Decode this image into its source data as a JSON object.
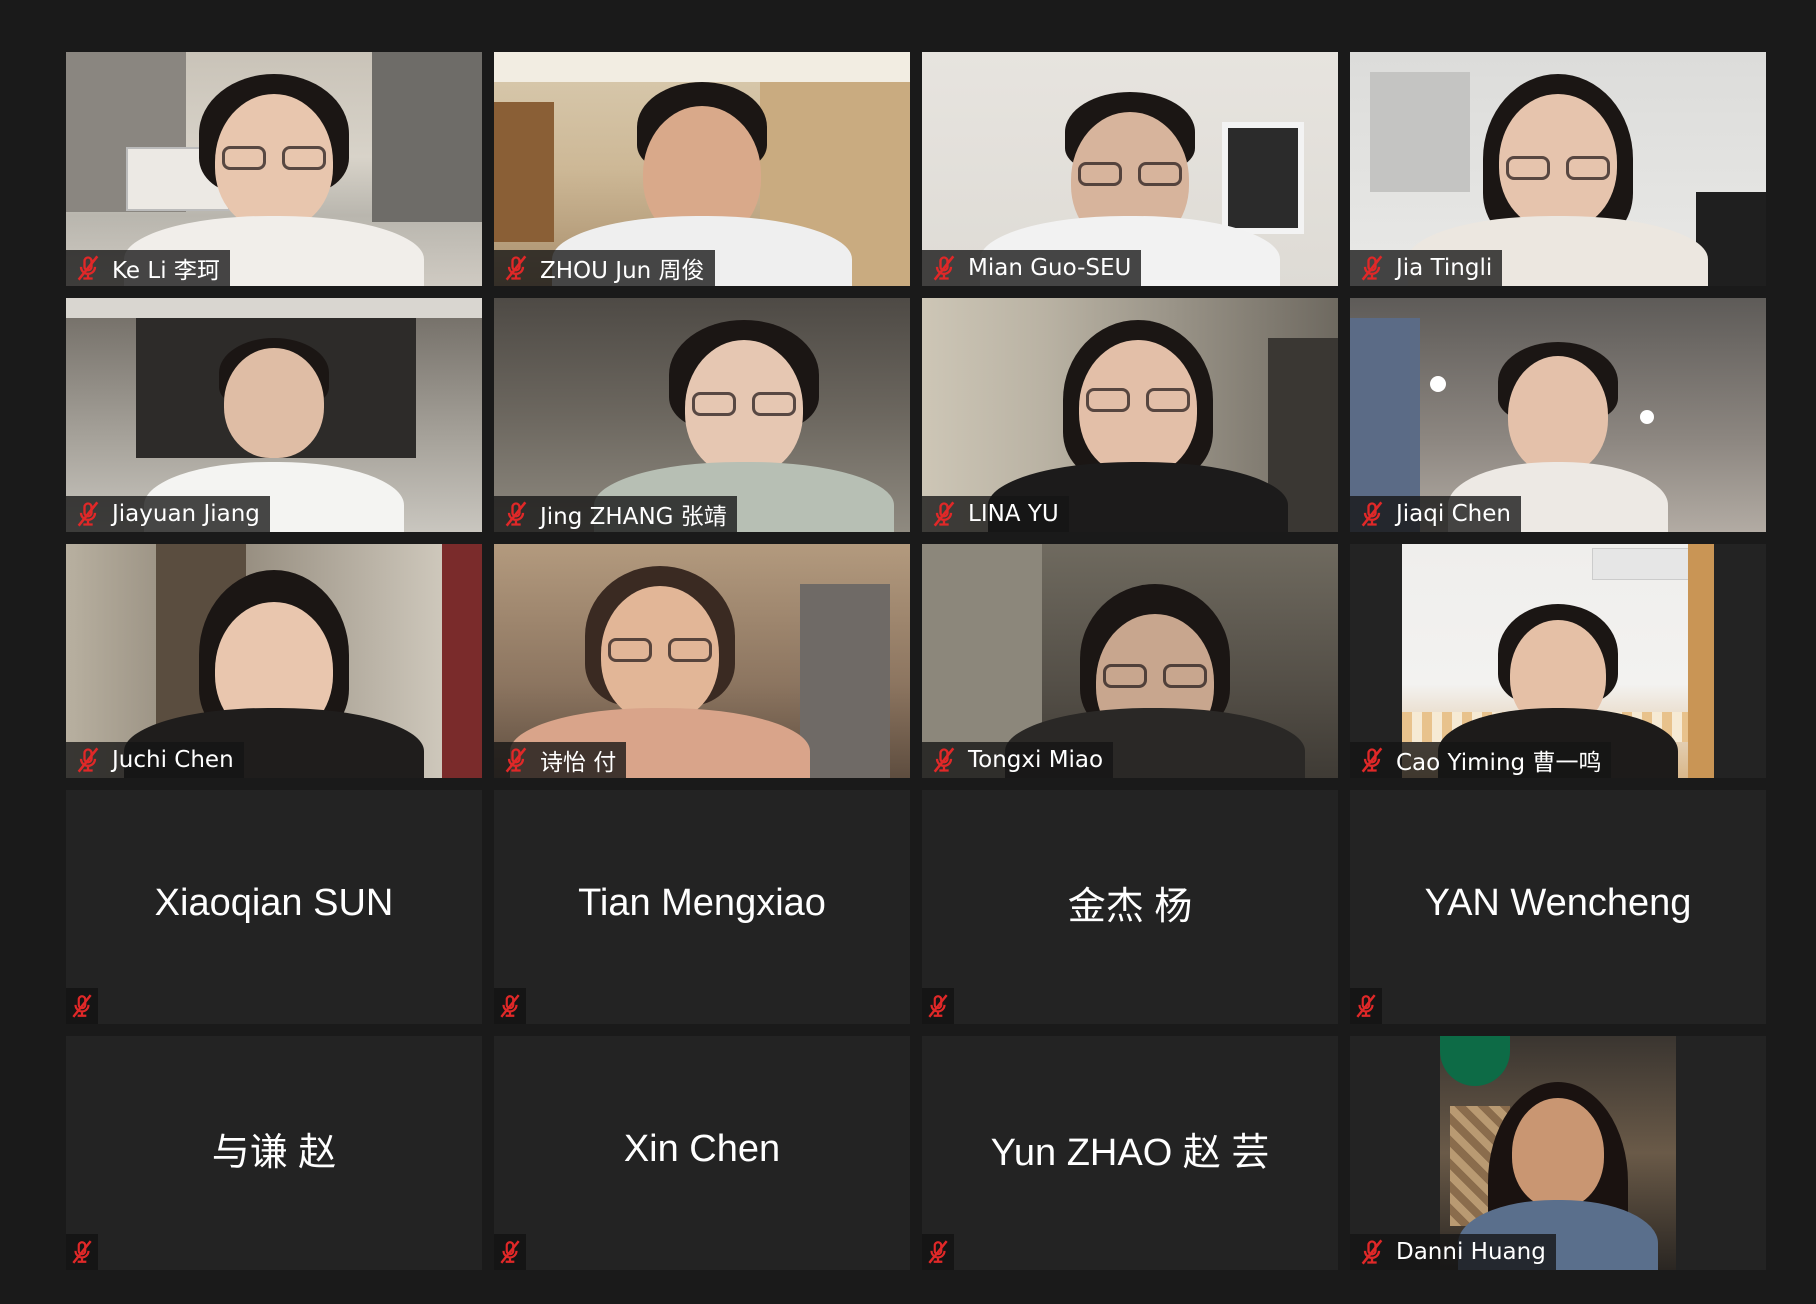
{
  "participants": [
    {
      "name": "Ke Li 李珂",
      "video": true,
      "muted": true
    },
    {
      "name": "ZHOU Jun 周俊",
      "video": true,
      "muted": true
    },
    {
      "name": "Mian Guo-SEU",
      "video": true,
      "muted": true
    },
    {
      "name": "Jia Tingli",
      "video": true,
      "muted": true
    },
    {
      "name": "Jiayuan Jiang",
      "video": true,
      "muted": true
    },
    {
      "name": "Jing ZHANG 张靖",
      "video": true,
      "muted": true
    },
    {
      "name": "LINA YU",
      "video": true,
      "muted": true
    },
    {
      "name": "Jiaqi Chen",
      "video": true,
      "muted": true
    },
    {
      "name": "Juchi Chen",
      "video": true,
      "muted": true
    },
    {
      "name": "诗怡 付",
      "video": true,
      "muted": true
    },
    {
      "name": "Tongxi Miao",
      "video": true,
      "muted": true
    },
    {
      "name": "Cao Yiming 曹一鸣",
      "video": true,
      "muted": true
    },
    {
      "name": "Xiaoqian SUN",
      "video": false,
      "muted": true
    },
    {
      "name": "Tian Mengxiao",
      "video": false,
      "muted": true
    },
    {
      "name": "金杰 杨",
      "video": false,
      "muted": true
    },
    {
      "name": "YAN Wencheng",
      "video": false,
      "muted": true
    },
    {
      "name": "与谦 赵",
      "video": false,
      "muted": true
    },
    {
      "name": "Xin Chen",
      "video": false,
      "muted": true
    },
    {
      "name": "Yun ZHAO 赵 芸",
      "video": false,
      "muted": true
    },
    {
      "name": "Danni Huang",
      "video": true,
      "muted": true
    }
  ],
  "icons": {
    "muted": "muted-microphone-icon"
  },
  "colors": {
    "background": "#1a1a1a",
    "tile": "#232323",
    "mute_red": "#e02828",
    "label_text": "#ffffff"
  }
}
